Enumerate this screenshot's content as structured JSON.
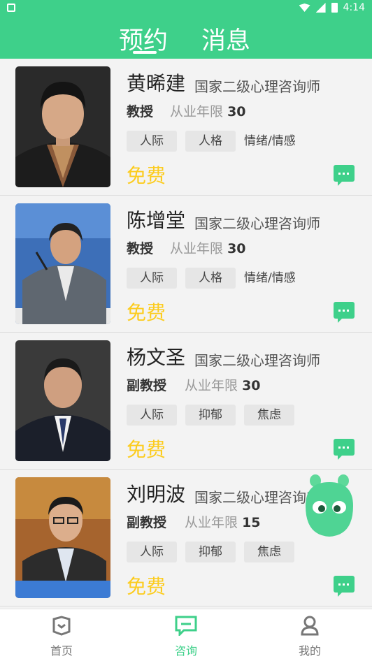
{
  "status_bar": {
    "time": "4:14"
  },
  "header": {
    "tabs": [
      {
        "label": "预约"
      },
      {
        "label": "消息"
      }
    ]
  },
  "counselors": [
    {
      "name": "黄晞建",
      "title": "国家二级心理咨询师",
      "rank": "教授",
      "years_label": "从业年限",
      "years": "30",
      "tags": [
        "人际",
        "人格",
        "情绪/情感"
      ],
      "price": "免费"
    },
    {
      "name": "陈增堂",
      "title": "国家二级心理咨询师",
      "rank": "教授",
      "years_label": "从业年限",
      "years": "30",
      "tags": [
        "人际",
        "人格",
        "情绪/情感"
      ],
      "price": "免费"
    },
    {
      "name": "杨文圣",
      "title": "国家二级心理咨询师",
      "rank": "副教授",
      "years_label": "从业年限",
      "years": "30",
      "tags": [
        "人际",
        "抑郁",
        "焦虑"
      ],
      "price": "免费"
    },
    {
      "name": "刘明波",
      "title": "国家二级心理咨询师",
      "rank": "副教授",
      "years_label": "从业年限",
      "years": "15",
      "tags": [
        "人际",
        "抑郁",
        "焦虑"
      ],
      "price": "免费"
    }
  ],
  "bottom_nav": [
    {
      "label": "首页",
      "icon": "home-icon"
    },
    {
      "label": "咨询",
      "icon": "chat-icon",
      "active": true
    },
    {
      "label": "我的",
      "icon": "profile-icon"
    }
  ],
  "colors": {
    "accent": "#3ed08a",
    "price": "#fccc1e"
  }
}
